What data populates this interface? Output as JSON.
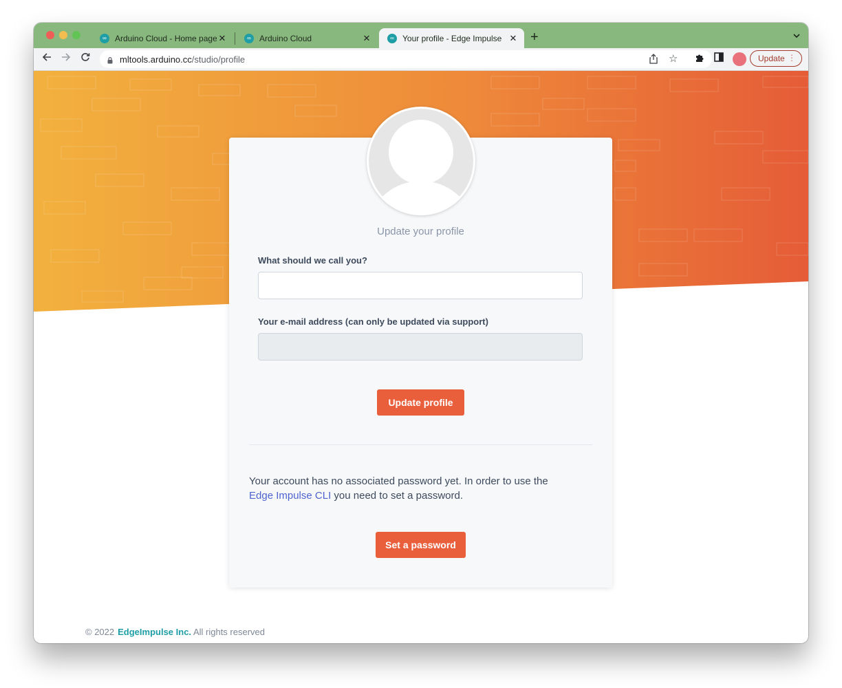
{
  "browser": {
    "tabs": [
      {
        "title": "Arduino Cloud - Home page",
        "active": false
      },
      {
        "title": "Arduino Cloud",
        "active": false
      },
      {
        "title": "Your profile - Edge Impulse",
        "active": true
      }
    ],
    "url_host": "mltools.arduino.cc",
    "url_path": "/studio/profile",
    "update_label": "Update"
  },
  "icons": {
    "back": "arrow-left-icon",
    "forward": "arrow-right-icon",
    "reload": "reload-icon",
    "lock": "lock-icon",
    "share": "share-icon",
    "bookmark": "star-icon",
    "extensions": "puzzle-icon",
    "sidepanel": "sidepanel-icon",
    "profile": "profile-avatar-icon",
    "menu": "kebab-menu-icon"
  },
  "profile": {
    "title": "Update your profile",
    "name_label": "What should we call you?",
    "name_value": "",
    "email_label": "Your e-mail address (can only be updated via support)",
    "email_value": "",
    "update_button": "Update profile",
    "notice_text_1": "Your account has no associated password yet. In order to use the",
    "notice_link": "Edge Impulse CLI",
    "notice_text_2": " you need to set a password.",
    "password_button": "Set a password"
  },
  "footer": {
    "copyright": "© 2022",
    "brand": "EdgeImpulse Inc.",
    "rights": "All rights reserved"
  },
  "colors": {
    "accent": "#e95f3c",
    "link": "#4e63cf",
    "brand_teal": "#1f9ea5",
    "tabstrip": "#88b87e",
    "hero_start": "#f2b13e",
    "hero_end": "#e55c37"
  }
}
